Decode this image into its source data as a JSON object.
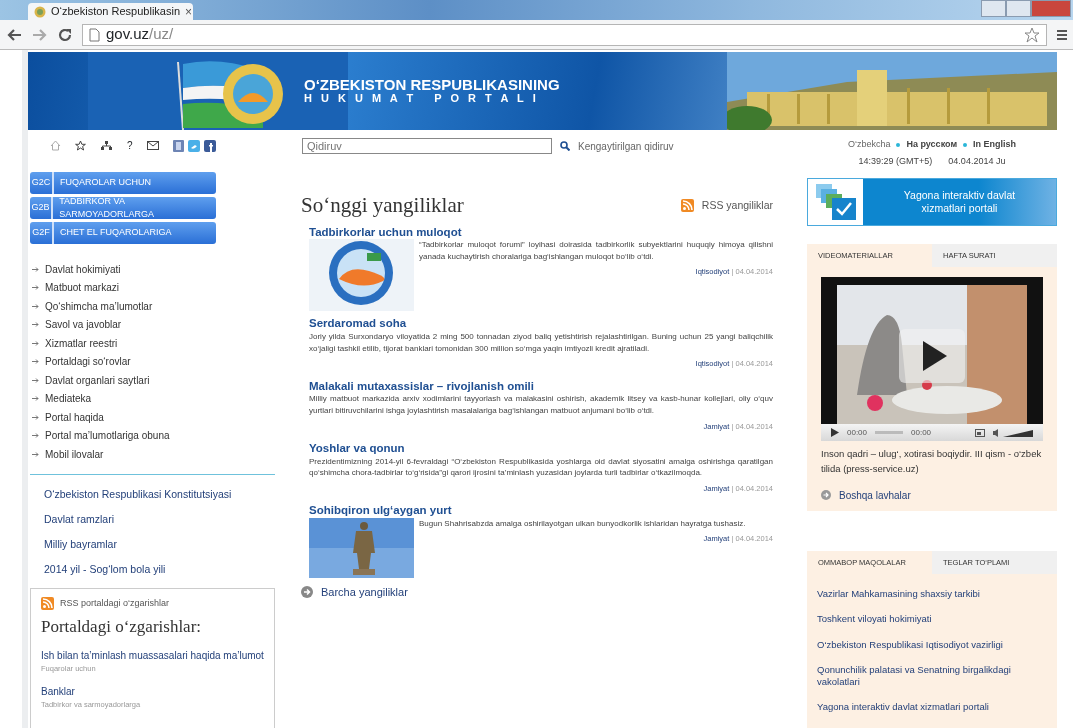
{
  "browser": {
    "tab_title": "O‘zbekiston Respublikasin",
    "tab_close": "×",
    "url_host": "gov.uz",
    "url_path": "/uz/"
  },
  "banner": {
    "title": "O‘ZBEKISTON RESPUBLIKASINING",
    "subtitle": "H U K U M A T   P O R T A L I"
  },
  "toolbar": {
    "help_glyph": "?"
  },
  "search": {
    "placeholder": "Qidiruv",
    "advanced_link": "Kengaytirilgan qidiruv"
  },
  "languages": [
    {
      "label": "O‘zbekcha",
      "selected": true
    },
    {
      "label": "На русском",
      "selected": false
    },
    {
      "label": "In English",
      "selected": false
    }
  ],
  "clock": {
    "time": "14:39:29 (GMT+5)",
    "date": "04.04.2014 Ju"
  },
  "left": {
    "services": [
      {
        "code": "G2C",
        "label": "FUQAROLAR UCHUN"
      },
      {
        "code": "G2B",
        "label": "TADBIRKOR VA SARMOYADORLARGA"
      },
      {
        "code": "G2F",
        "label": "CHET EL FUQAROLARIGA"
      }
    ],
    "menu": [
      "Davlat hokimiyati",
      "Matbuot markazi",
      "Qo‘shimcha ma’lumotlar",
      "Savol va javoblar",
      "Xizmatlar reestri",
      "Portaldagi so‘rovlar",
      "Davlat organlari saytlari",
      "Mediateka",
      "Portal haqida",
      "Portal ma’lumotlariga obuna",
      "Mobil ilovalar"
    ],
    "links": [
      "O‘zbekiston Respublikasi Konstitutsiyasi",
      "Davlat ramzlari",
      "Milliy bayramlar",
      "2014 yil - Sog‘lom bola yili"
    ],
    "changes": {
      "rss_label": "RSS portaldagi o‘zgarishlar",
      "title": "Portaldagi o‘zgarishlar:",
      "items": [
        {
          "title": "Ish bilan ta’minlash muassasalari haqida ma’lumot",
          "category": "Fuqarolar uchun"
        },
        {
          "title": "Banklar",
          "category": "Tadbirkor va sarmoyadorlarga"
        }
      ]
    }
  },
  "news": {
    "title": "So‘nggi yangiliklar",
    "rss_label": "RSS yangiliklar",
    "items": [
      {
        "kind": "emblem",
        "title": "Tadbirkorlar uchun muloqot",
        "text": "“Tadbirkorlar muloqot forumi” loyihasi doirasida tadbirkorlik subyektlarini huquqiy himoya qilishni yanada kuchaytirish choralariga bag‘ishlangan muloqot bo‘lib o‘tdi.",
        "category": "Iqtisodiyot",
        "date": "| 04.04.2014"
      },
      {
        "kind": "text",
        "title": "Serdaromad soha",
        "text": "Joriy yilda Surxondaryo viloyatida 2 ming 500 tonnadan ziyod baliq yetishtirish rejalashtirilgan. Buning uchun 25 yangi baliqchilik xo‘jaligi tashkil etilib, tijorat banklari tomonidan 300 million so‘mga yaqin imtiyozli kredit ajratiladi.",
        "category": "Iqtisodiyot",
        "date": "| 04.04.2014"
      },
      {
        "kind": "text",
        "title": "Malakali mutaxassislar – rivojlanish omili",
        "text": "Milliy matbuot markazida arxiv xodimlarini tayyorlash va malakasini oshirish, akademik litsey va kasb-hunar kollejlari, oliy o‘quv yurtlari bitiruvchilarini ishga joylashtirish masalalariga bag‘ishlangan matbuot anjumani bo‘lib o‘tdi.",
        "category": "Jamiyat",
        "date": "| 04.04.2014"
      },
      {
        "kind": "text",
        "title": "Yoshlar va qonun",
        "text": "Prezidentimizning 2014-yil 6-fevraldagi “O‘zbekiston Respublikasida yoshlarga oid davlat siyosatini amalga oshirishga qaratilgan qo‘shimcha chora-tadbirlar to‘g‘risida”gi qarori ijrosini ta’minlash yuzasidan joylarda turli tadbirlar o‘tkazilmoqda.",
        "category": "Jamiyat",
        "date": "| 04.04.2014"
      },
      {
        "kind": "statue",
        "title": "Sohibqiron ulg‘aygan yurt",
        "text": "Bugun Shahrisabzda amalga oshirilayotgan ulkan bunyodkorlik ishlaridan hayratga tushasiz.",
        "category": "Jamiyat",
        "date": "| 04.04.2014"
      }
    ],
    "all_link": "Barcha yangiliklar"
  },
  "right": {
    "portal_banner": "Yagona interaktiv davlat xizmatlari portali",
    "media_tabs": [
      {
        "label": "VIDEOMATERIALLAR",
        "selected": true
      },
      {
        "label": "HAFTA SURATI",
        "selected": false
      }
    ],
    "video": {
      "time_current": "00:00",
      "time_total": "00:00",
      "caption": "Inson qadri – ulug‘, xotirasi boqiydir. III qism - o‘zbek tilida (press-service.uz)",
      "more_link": "Boshqa lavhalar"
    },
    "article_tabs": [
      {
        "label": "OMMABOP MAQOLALAR",
        "selected": true
      },
      {
        "label": "TEGLAR TO‘PLAMI",
        "selected": false
      }
    ],
    "articles": [
      "Vazirlar Mahkamasining shaxsiy tarkibi",
      "Toshkent viloyati hokimiyati",
      "O‘zbekiston Respublikasi Iqtisodiyot vazirligi",
      "Qonunchilik palatasi va Senatning birgalikdagi vakolatlari",
      "Yagona interaktiv davlat xizmatlari portali"
    ]
  }
}
